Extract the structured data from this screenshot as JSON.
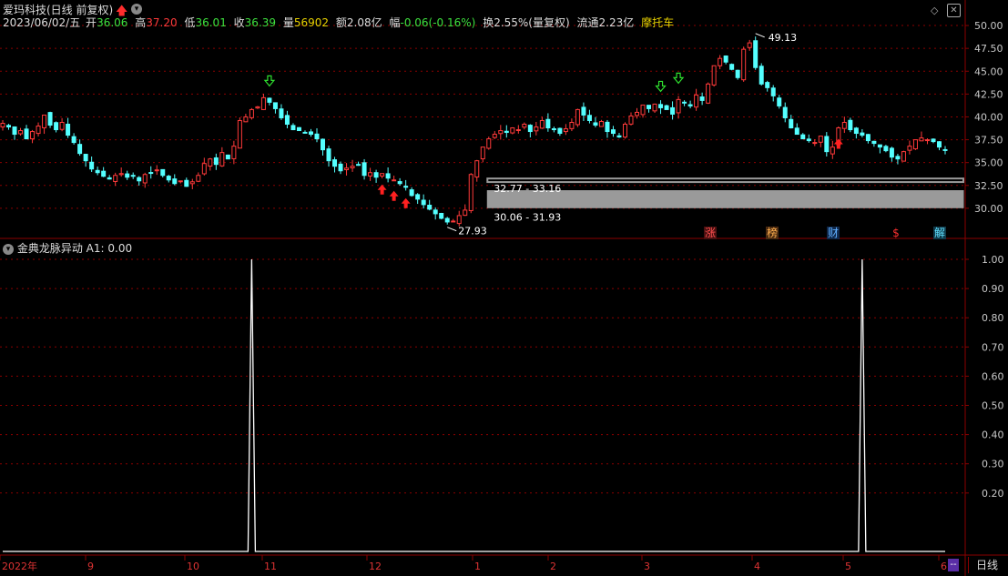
{
  "header": {
    "title": "爱玛科技(日线 前复权)",
    "date": "2023/06/02/五",
    "open_label": "开",
    "open": "36.06",
    "high_label": "高",
    "high": "37.20",
    "low_label": "低",
    "low": "36.01",
    "close_label": "收",
    "close": "36.39",
    "volume_label": "量",
    "volume": "56902",
    "amount_label": "额",
    "amount": "2.08亿",
    "change_label": "幅",
    "change": "-0.06(-0.16%)",
    "turnover": "换2.55%(量复权)",
    "float_cap": "流通2.23亿",
    "sector": "摩托车"
  },
  "indicator": {
    "name": "金典龙脉异动",
    "label": "A1: 0.00"
  },
  "markers": [
    "涨",
    "榜",
    "财",
    "$",
    "解"
  ],
  "timeframe_tab": "日线",
  "colors": {
    "up": "#ff3a3a",
    "down": "#54ffff",
    "grid": "#8b0000",
    "axis_text": "#c8c8c8",
    "ma": "#ffffff",
    "band": "#9a9a9a"
  },
  "chart_data": [
    {
      "type": "candlestick",
      "y_ticks": [
        30.0,
        32.5,
        35.0,
        37.5,
        40.0,
        42.5,
        45.0,
        47.5,
        50.0
      ],
      "ylim": [
        27.5,
        51.0
      ],
      "x_month_labels": [
        "2022年",
        "9",
        "10",
        "11",
        "12",
        "1",
        "2",
        "3",
        "4",
        "5",
        "6"
      ],
      "annotations": {
        "max": "49.13",
        "min": "27.93",
        "band_upper": "32.77 - 33.16",
        "band_lower": "30.06 - 31.93"
      },
      "bands": [
        {
          "from": 32.77,
          "to": 33.16
        },
        {
          "from": 30.06,
          "to": 31.93
        }
      ],
      "close_path": [
        39.3,
        38.9,
        38.1,
        38.5,
        37.6,
        38.4,
        39.0,
        40.2,
        39.1,
        38.6,
        39.4,
        38.0,
        37.2,
        36.0,
        35.2,
        34.3,
        33.9,
        33.5,
        33.2,
        33.6,
        33.8,
        33.4,
        33.5,
        33.0,
        33.7,
        33.9,
        34.2,
        33.6,
        33.1,
        32.7,
        33.0,
        32.4,
        32.9,
        33.6,
        34.9,
        35.4,
        34.8,
        36.1,
        35.4,
        36.8,
        39.6,
        40.0,
        40.8,
        41.1,
        42.1,
        41.6,
        40.9,
        39.9,
        39.2,
        38.6,
        38.5,
        38.3,
        38.1,
        37.6,
        36.4,
        35.2,
        34.6,
        34.1,
        34.4,
        34.6,
        34.7,
        33.6,
        33.9,
        33.4,
        33.8,
        33.3,
        33.1,
        32.7,
        32.3,
        31.4,
        31.0,
        30.4,
        29.9,
        29.4,
        28.9,
        28.5,
        28.6,
        29.2,
        29.8,
        33.7,
        35.2,
        36.7,
        37.6,
        38.1,
        38.5,
        38.3,
        38.8,
        38.6,
        39.2,
        38.4,
        38.9,
        39.6,
        38.8,
        38.7,
        38.2,
        38.7,
        39.4,
        40.8,
        40.2,
        39.6,
        39.1,
        39.5,
        38.4,
        38.2,
        37.8,
        39.2,
        40.1,
        40.5,
        41.3,
        40.9,
        41.4,
        41.0,
        40.8,
        40.3,
        41.9,
        41.6,
        41.2,
        42.4,
        41.8,
        43.6,
        45.6,
        46.4,
        46.0,
        45.2,
        44.3,
        47.4,
        48.1,
        45.4,
        43.6,
        43.2,
        42.3,
        41.2,
        39.9,
        38.8,
        38.1,
        37.6,
        37.4,
        37.2,
        37.9,
        36.2,
        36.7,
        38.8,
        39.4,
        38.6,
        38.2,
        38.0,
        37.4,
        37.1,
        36.7,
        36.3,
        35.6,
        35.4,
        36.2,
        36.8,
        37.5,
        37.7,
        37.5,
        37.3,
        36.7,
        36.4
      ]
    },
    {
      "type": "line",
      "name": "A1",
      "y_ticks": [
        0.2,
        0.3,
        0.4,
        0.5,
        0.6,
        0.7,
        0.8,
        0.9,
        1.0
      ],
      "ylim": [
        0,
        1.0
      ],
      "spikes": [
        {
          "index": 42,
          "value": 1.0
        },
        {
          "index": 145,
          "value": 1.0
        }
      ]
    }
  ]
}
